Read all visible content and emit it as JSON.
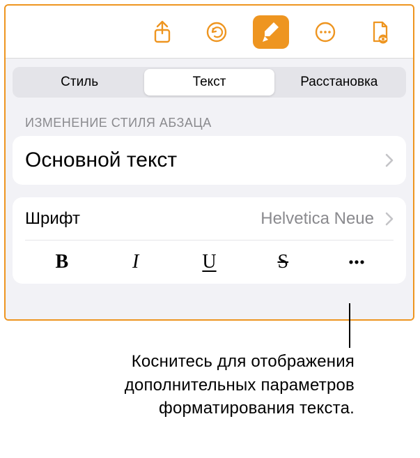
{
  "toolbar": {
    "share_icon": "share-icon",
    "undo_icon": "undo-icon",
    "format_icon": "brush-icon",
    "more_icon": "more-icon",
    "document_icon": "document-view-icon"
  },
  "tabs": [
    {
      "label": "Стиль",
      "active": false
    },
    {
      "label": "Текст",
      "active": true
    },
    {
      "label": "Расстановка",
      "active": false
    }
  ],
  "section_header": "Изменение стиля абзаца",
  "paragraph_style": {
    "name": "Основной текст"
  },
  "font": {
    "label": "Шрифт",
    "value": "Helvetica Neue"
  },
  "style_buttons": {
    "bold": "B",
    "italic": "I",
    "underline": "U",
    "strikethrough": "S",
    "more": "more-icon"
  },
  "caption": "Коснитесь для отображения дополнительных параметров форматирования текста."
}
